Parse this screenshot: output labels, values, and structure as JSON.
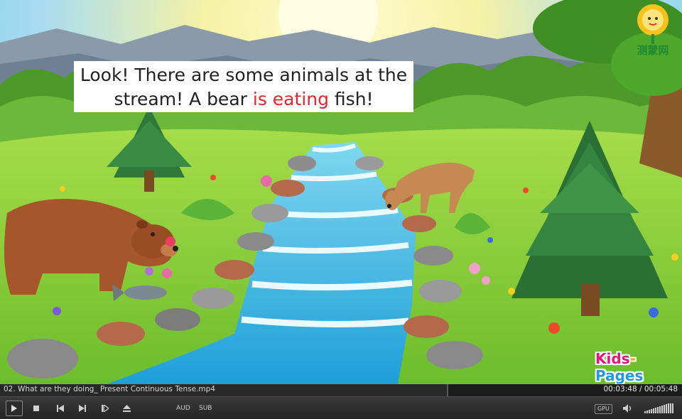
{
  "video": {
    "caption_prefix": "Look! There are some animals at the stream! A bear ",
    "caption_highlight": "is eating",
    "caption_suffix": " fish!",
    "highlight_color": "#e0262e",
    "logo_top_text": "测蒙网",
    "brand_part1": "Kids",
    "brand_dash": "-",
    "brand_part2": "Pages"
  },
  "player": {
    "file_name": "02. What are they doing_ Present Continuous Tense.mp4",
    "time_display": "00:03:48 / 00:05:48",
    "progress_percent": 65.5,
    "volume_percent": 100,
    "buttons": {
      "aud_label": "AUD",
      "sub_label": "SUB",
      "gpu_label": "GPU"
    },
    "icons": [
      "play-icon",
      "stop-icon",
      "prev-icon",
      "next-icon",
      "frame-step-icon",
      "eject-icon",
      "speaker-icon"
    ]
  }
}
